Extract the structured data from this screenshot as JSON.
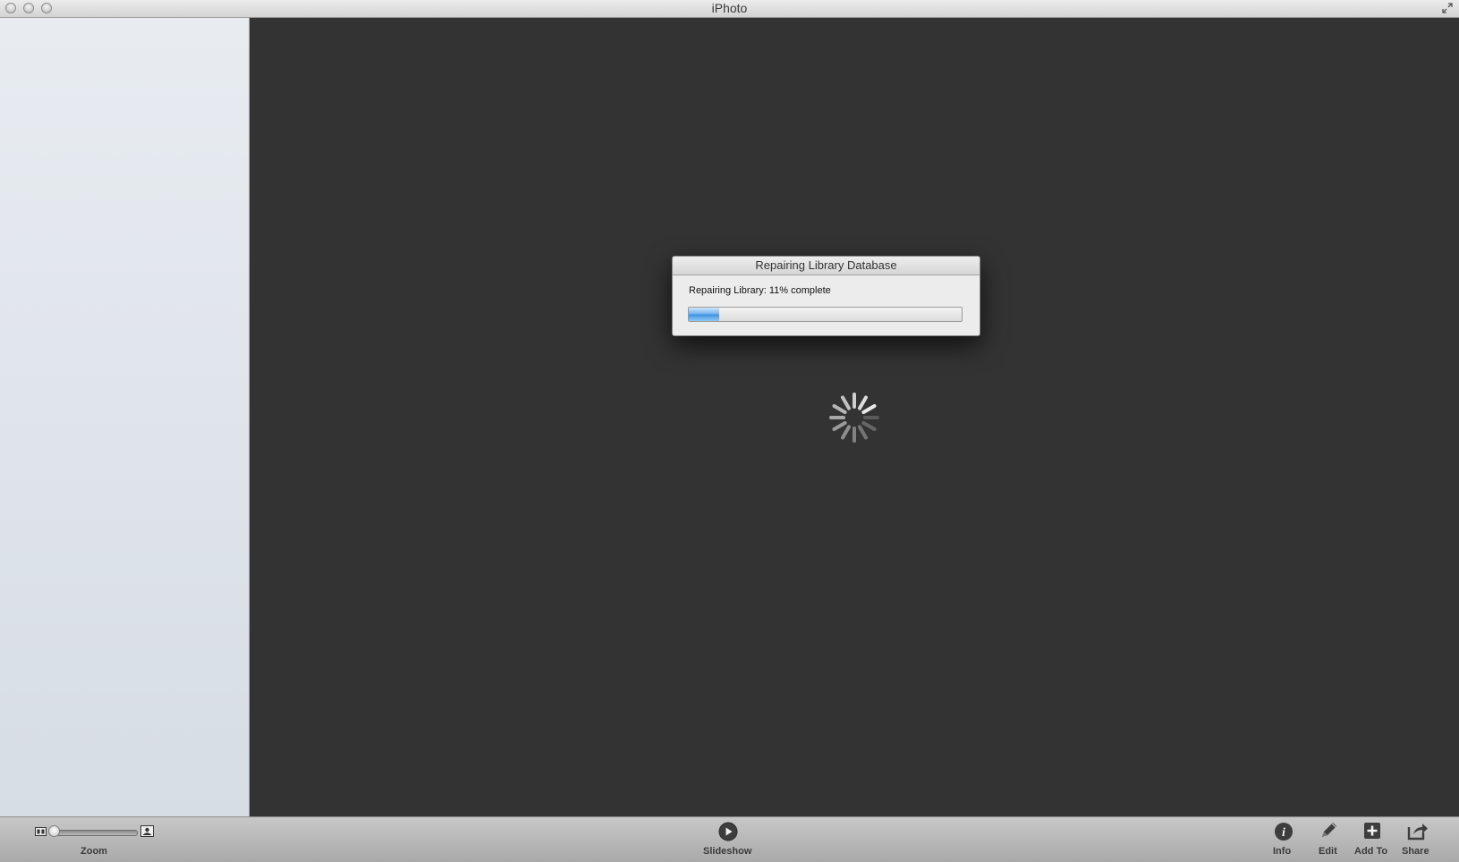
{
  "window": {
    "title": "iPhoto"
  },
  "dialog": {
    "title": "Repairing Library Database",
    "message": "Repairing Library: 11% complete",
    "progress": 0.11
  },
  "toolbar": {
    "zoom_label": "Zoom",
    "slideshow_label": "Slideshow",
    "info_label": "Info",
    "edit_label": "Edit",
    "add_to_label": "Add To",
    "share_label": "Share"
  },
  "icons": {
    "close": "close-button",
    "minimize": "minimize-button",
    "zoom": "zoom-button",
    "fullscreen": "fullscreen-icon",
    "spinner": "spinner-icon",
    "slideshow": "play-icon",
    "info": "info-icon",
    "edit": "pencil-icon",
    "add_to": "plus-icon",
    "share": "share-icon",
    "zoom_small": "small-thumbnail-icon",
    "zoom_large": "large-thumbnail-icon"
  }
}
